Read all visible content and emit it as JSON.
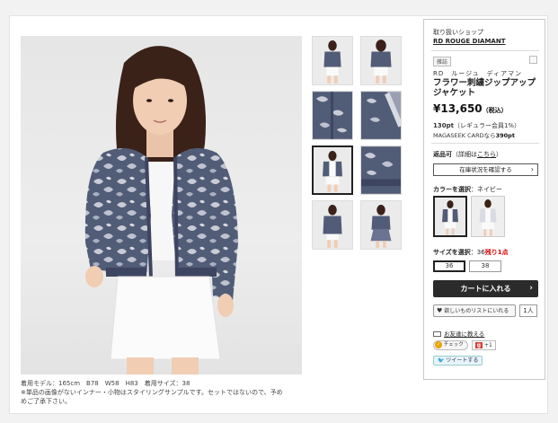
{
  "caption": {
    "line1": "着用モデル：165cm　B78　W58　H83　着用サイズ：38",
    "line2": "※単品の画像がないインナー・小物はスタイリングサンプルです。セットではないので、予め",
    "line3": "めご了承下さい。"
  },
  "panel": {
    "shop_label": "取り扱いショップ",
    "shop_name": "RD ROUGE DIAMANT",
    "tag": "雑誌",
    "brand": "RD　ルージュ　ディアマン",
    "title": "フラワー刺繍ジップアップジャケット",
    "price": "¥13,650",
    "price_tax": "（税込）",
    "points": "130pt",
    "points_note": "（レギュラー会員1%）",
    "card_text": "MAGASEEK CARDなら",
    "card_points": "390pt",
    "returns_label": "返品可",
    "returns_detail_pre": "（詳細は",
    "returns_detail_link": "こちら",
    "returns_detail_post": "）",
    "stock_button": "在庫状況を確認する",
    "color_label": "カラーを選択",
    "color_selected": "：ネイビー",
    "size_label": "サイズを選択",
    "size_selected": "：36",
    "size_stock": "残り1点",
    "sizes": [
      "36",
      "38"
    ],
    "cart_button": "カートに入れる",
    "wish_button": "欲しいものリストにいれる",
    "wish_count": "1人",
    "share_friend": "お友達に教える",
    "check_button": "チェック",
    "gplus_button": "+1",
    "tweet_button": "ツイートする"
  },
  "colors": {
    "navy": "#4a5570",
    "light": "#d8dbe3",
    "accent_red": "#d00000",
    "cart_bg": "#2b2b2b"
  }
}
